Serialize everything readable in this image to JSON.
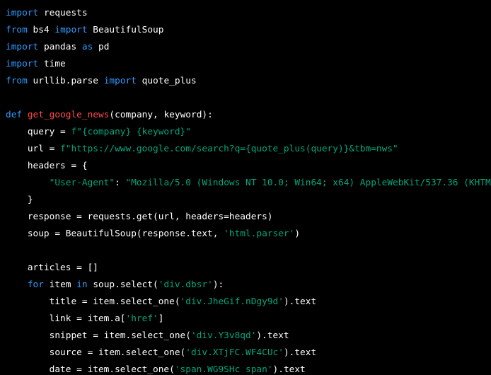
{
  "colors": {
    "background": "#000000",
    "keyword": "#2f9bff",
    "function_name": "#ff4a4a",
    "string": "#00a67d",
    "text": "#ffffff"
  },
  "code_lines": [
    [
      {
        "t": "kw",
        "v": "import"
      },
      {
        "t": "txt",
        "v": " requests"
      }
    ],
    [
      {
        "t": "kw",
        "v": "from"
      },
      {
        "t": "txt",
        "v": " bs4 "
      },
      {
        "t": "kw",
        "v": "import"
      },
      {
        "t": "txt",
        "v": " BeautifulSoup"
      }
    ],
    [
      {
        "t": "kw",
        "v": "import"
      },
      {
        "t": "txt",
        "v": " pandas "
      },
      {
        "t": "kw",
        "v": "as"
      },
      {
        "t": "txt",
        "v": " pd"
      }
    ],
    [
      {
        "t": "kw",
        "v": "import"
      },
      {
        "t": "txt",
        "v": " time"
      }
    ],
    [
      {
        "t": "kw",
        "v": "from"
      },
      {
        "t": "txt",
        "v": " urllib.parse "
      },
      {
        "t": "kw",
        "v": "import"
      },
      {
        "t": "txt",
        "v": " quote_plus"
      }
    ],
    [],
    [
      {
        "t": "kw",
        "v": "def"
      },
      {
        "t": "txt",
        "v": " "
      },
      {
        "t": "fn",
        "v": "get_google_news"
      },
      {
        "t": "txt",
        "v": "(company, keyword):"
      }
    ],
    [
      {
        "t": "txt",
        "v": "    query = "
      },
      {
        "t": "str",
        "v": "f\"{company} {keyword}\""
      }
    ],
    [
      {
        "t": "txt",
        "v": "    url = "
      },
      {
        "t": "str",
        "v": "f\"https://www.google.com/search?q={quote_plus(query)}&tbm=nws\""
      }
    ],
    [
      {
        "t": "txt",
        "v": "    headers = {"
      }
    ],
    [
      {
        "t": "txt",
        "v": "        "
      },
      {
        "t": "str",
        "v": "\"User-Agent\""
      },
      {
        "t": "txt",
        "v": ": "
      },
      {
        "t": "str",
        "v": "\"Mozilla/5.0 (Windows NT 10.0; Win64; x64) AppleWebKit/537.36 (KHTM"
      }
    ],
    [
      {
        "t": "txt",
        "v": "    }"
      }
    ],
    [
      {
        "t": "txt",
        "v": "    response = requests.get(url, headers=headers)"
      }
    ],
    [
      {
        "t": "txt",
        "v": "    soup = BeautifulSoup(response.text, "
      },
      {
        "t": "str",
        "v": "'html.parser'"
      },
      {
        "t": "txt",
        "v": ")"
      }
    ],
    [],
    [
      {
        "t": "txt",
        "v": "    articles = []"
      }
    ],
    [
      {
        "t": "txt",
        "v": "    "
      },
      {
        "t": "kw",
        "v": "for"
      },
      {
        "t": "txt",
        "v": " item "
      },
      {
        "t": "kw",
        "v": "in"
      },
      {
        "t": "txt",
        "v": " soup.select("
      },
      {
        "t": "str",
        "v": "'div.dbsr'"
      },
      {
        "t": "txt",
        "v": "):"
      }
    ],
    [
      {
        "t": "txt",
        "v": "        title = item.select_one("
      },
      {
        "t": "str",
        "v": "'div.JheGif.nDgy9d'"
      },
      {
        "t": "txt",
        "v": ").text"
      }
    ],
    [
      {
        "t": "txt",
        "v": "        link = item.a["
      },
      {
        "t": "str",
        "v": "'href'"
      },
      {
        "t": "txt",
        "v": "]"
      }
    ],
    [
      {
        "t": "txt",
        "v": "        snippet = item.select_one("
      },
      {
        "t": "str",
        "v": "'div.Y3v8qd'"
      },
      {
        "t": "txt",
        "v": ").text"
      }
    ],
    [
      {
        "t": "txt",
        "v": "        source = item.select_one("
      },
      {
        "t": "str",
        "v": "'div.XTjFC.WF4CUc'"
      },
      {
        "t": "txt",
        "v": ").text"
      }
    ],
    [
      {
        "t": "txt",
        "v": "        date = item.select_one("
      },
      {
        "t": "str",
        "v": "'span.WG9SHc span'"
      },
      {
        "t": "txt",
        "v": ").text"
      }
    ]
  ]
}
